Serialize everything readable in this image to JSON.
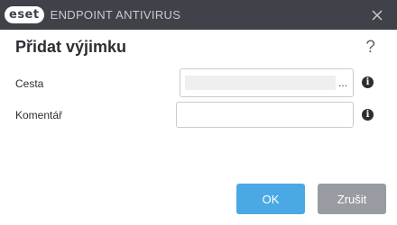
{
  "titlebar": {
    "logo_text": "eset",
    "product": "ENDPOINT ANTIVIRUS",
    "close_icon": "close-icon"
  },
  "dialog": {
    "title": "Přidat výjimku",
    "help": "?"
  },
  "form": {
    "path": {
      "label": "Cesta",
      "value": "",
      "browse": "..."
    },
    "comment": {
      "label": "Komentář",
      "value": ""
    },
    "info_glyph": "i"
  },
  "buttons": {
    "ok": "OK",
    "cancel": "Zrušit"
  },
  "colors": {
    "titlebar": "#3f4249",
    "primary": "#4aa9e4",
    "secondary": "#989ca2"
  }
}
